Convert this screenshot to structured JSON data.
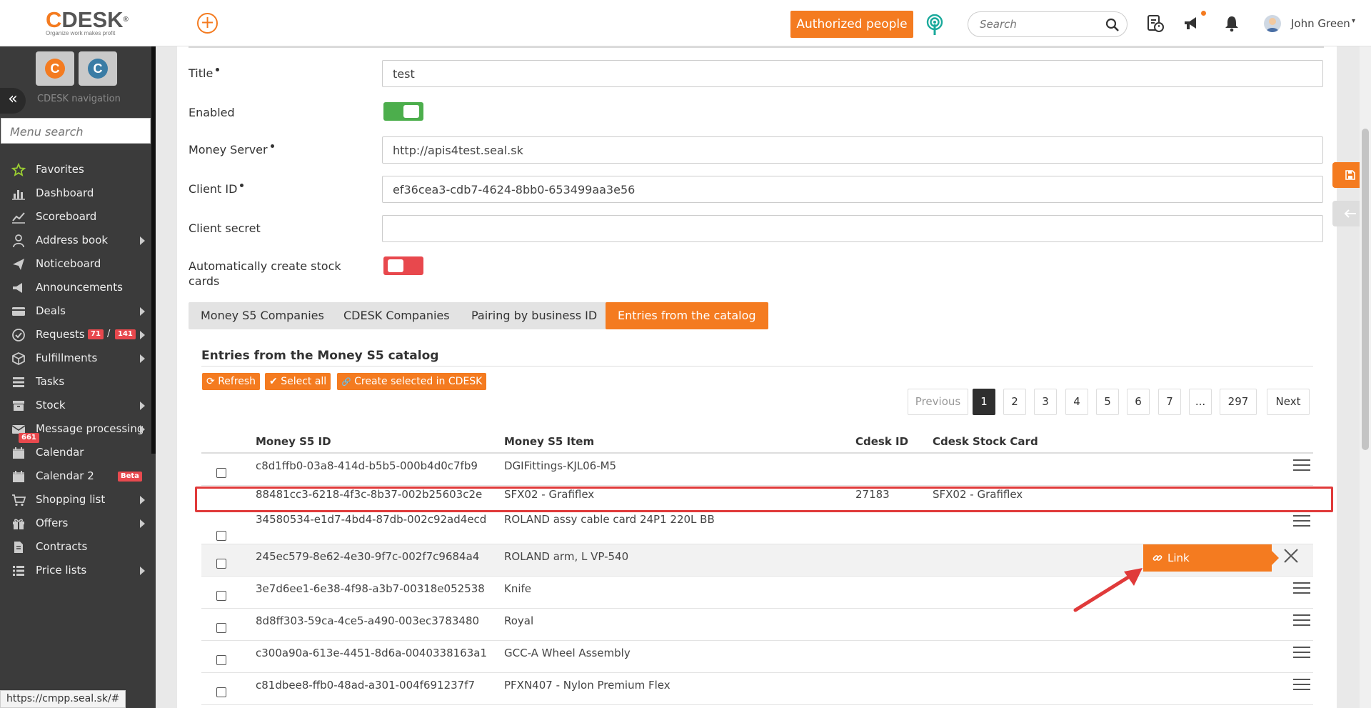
{
  "header": {
    "logo_text": "DESK",
    "logo_c": "C",
    "logo_reg": "®",
    "logo_tagline": "Organize work makes profit",
    "add_icon": "plus-circle-icon",
    "authorized_people_label": "Authorized people",
    "search_placeholder": "Search",
    "user_name": "John Green",
    "caret": "▾"
  },
  "sidebar": {
    "apps": [
      "C",
      "C"
    ],
    "collapse_glyph": "«",
    "caption": "CDESK navigation",
    "menu_search_placeholder": "Menu search",
    "items": [
      {
        "label": "Favorites",
        "icon": "star-icon",
        "submenu": false
      },
      {
        "label": "Dashboard",
        "icon": "bar-chart-icon",
        "submenu": false
      },
      {
        "label": "Scoreboard",
        "icon": "line-chart-icon",
        "submenu": false
      },
      {
        "label": "Address book",
        "icon": "user-icon",
        "submenu": true
      },
      {
        "label": "Noticeboard",
        "icon": "paper-plane-icon",
        "submenu": false
      },
      {
        "label": "Announcements",
        "icon": "megaphone-icon",
        "submenu": false
      },
      {
        "label": "Deals",
        "icon": "credit-card-icon",
        "submenu": true
      },
      {
        "label": "Requests",
        "icon": "check-circle-icon",
        "submenu": true,
        "badge1": "71",
        "sep": "/",
        "badge2": "141"
      },
      {
        "label": "Fulfillments",
        "icon": "cube-icon",
        "submenu": true
      },
      {
        "label": "Tasks",
        "icon": "tasks-icon",
        "submenu": false
      },
      {
        "label": "Stock",
        "icon": "archive-icon",
        "submenu": true
      },
      {
        "label": "Message processing",
        "icon": "envelope-icon",
        "submenu": true,
        "badge1": "661"
      },
      {
        "label": "Calendar",
        "icon": "calendar-icon",
        "submenu": false
      },
      {
        "label": "Calendar 2",
        "icon": "calendar-icon",
        "submenu": false,
        "beta": "Beta"
      },
      {
        "label": "Shopping list",
        "icon": "cart-icon",
        "submenu": true
      },
      {
        "label": "Offers",
        "icon": "gift-icon",
        "submenu": true
      },
      {
        "label": "Contracts",
        "icon": "file-icon",
        "submenu": false
      },
      {
        "label": "Price lists",
        "icon": "list-icon",
        "submenu": true
      }
    ],
    "status_url": "https://cmpp.seal.sk/#"
  },
  "form": {
    "title_label": "Title",
    "title_value": "test",
    "enabled_label": "Enabled",
    "enabled_on": true,
    "money_server_label": "Money Server",
    "money_server_value": "http://apis4test.seal.sk",
    "client_id_label": "Client ID",
    "client_id_value": "ef36cea3-cdb7-4624-8bb0-653499aa3e56",
    "client_secret_label": "Client secret",
    "client_secret_value": "",
    "auto_stock_label": "Automatically create stock cards",
    "auto_stock_on": false
  },
  "tabs": [
    {
      "label": "Money S5 Companies",
      "active": false
    },
    {
      "label": "CDESK Companies",
      "active": false
    },
    {
      "label": "Pairing by business ID",
      "active": false
    },
    {
      "label": "Entries from the catalog",
      "active": true
    }
  ],
  "catalog": {
    "title": "Entries from the Money S5 catalog",
    "actions": [
      {
        "label": "Refresh",
        "icon": "refresh-icon",
        "glyph": "⟳"
      },
      {
        "label": "Select all",
        "icon": "check-icon",
        "glyph": "✔"
      },
      {
        "label": "Create selected in CDESK",
        "icon": "link-icon",
        "glyph": "🔗"
      }
    ],
    "pagination": {
      "previous": "Previous",
      "pages": [
        "1",
        "2",
        "3",
        "4",
        "5",
        "6",
        "7",
        "...",
        "297"
      ],
      "active_page": "1",
      "next": "Next"
    },
    "columns": [
      "Money S5 ID",
      "Money S5 Item",
      "Cdesk ID",
      "Cdesk Stock Card"
    ],
    "rows": [
      {
        "id": "c8d1ffb0-03a8-414d-b5b5-000b4d0c7fb9",
        "item": "DGIFittings-KJL06-M5",
        "cdesk_id": "",
        "stock_card": "",
        "checkbox": true
      },
      {
        "id": "88481cc3-6218-4f3c-8b37-002b25603c2e",
        "item": "SFX02 - Grafiflex",
        "cdesk_id": "27183",
        "stock_card": "SFX02 - Grafiflex",
        "checkbox": false
      },
      {
        "id": "34580534-e1d7-4bd4-87db-002c92ad4ecd",
        "item": "ROLAND assy cable card 24P1 220L BB",
        "cdesk_id": "",
        "stock_card": "",
        "checkbox": true
      },
      {
        "id": "245ec579-8e62-4e30-9f7c-002f7c9684a4",
        "item": "ROLAND arm, L VP-540",
        "cdesk_id": "",
        "stock_card": "",
        "checkbox": true
      },
      {
        "id": "3e7d6ee1-6e38-4f98-a3b7-00318e052538",
        "item": "Knife",
        "cdesk_id": "",
        "stock_card": "",
        "checkbox": true
      },
      {
        "id": "8d8ff303-59ca-4ce5-a490-003ec3783480",
        "item": "Royal",
        "cdesk_id": "",
        "stock_card": "",
        "checkbox": true
      },
      {
        "id": "c300a90a-613e-4451-8d6a-0040338163a1",
        "item": "GCC-A Wheel Assembly",
        "cdesk_id": "",
        "stock_card": "",
        "checkbox": true
      },
      {
        "id": "c81dbee8-ffb0-48ad-a301-004f691237f7",
        "item": "PFXN407 - Nylon Premium Flex",
        "cdesk_id": "",
        "stock_card": "",
        "checkbox": true
      }
    ],
    "link_popup_label": "Link",
    "link_popup_icon": "link-icon"
  },
  "colors": {
    "accent": "#f47b20",
    "sidebar_bg": "#3b3b3b",
    "toggle_on": "#4cae4c",
    "toggle_off": "#e8484d",
    "highlight": "#e03a3a"
  }
}
